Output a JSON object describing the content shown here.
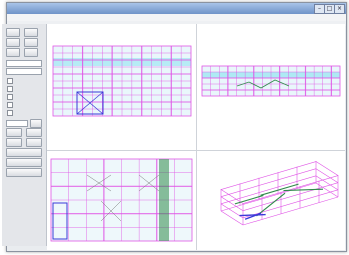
{
  "window": {
    "title": "",
    "menus": [
      "",
      "",
      "",
      "",
      "",
      ""
    ]
  },
  "panel": {
    "buttons": [
      "",
      "",
      "",
      "",
      "",
      ""
    ],
    "options": [
      "",
      "",
      "",
      "",
      ""
    ],
    "actions": [
      "",
      "",
      "",
      ""
    ]
  },
  "viewports": [
    {
      "title": "",
      "footer": ""
    },
    {
      "title": "",
      "footer": ""
    },
    {
      "title": "",
      "footer": ""
    },
    {
      "title": "",
      "footer": ""
    }
  ],
  "colors": {
    "grid_magenta": "#e055e6",
    "grid_cyan": "#9fe6f2",
    "grid_blue": "#3a3ad8",
    "grid_green": "#2f8a4a"
  }
}
